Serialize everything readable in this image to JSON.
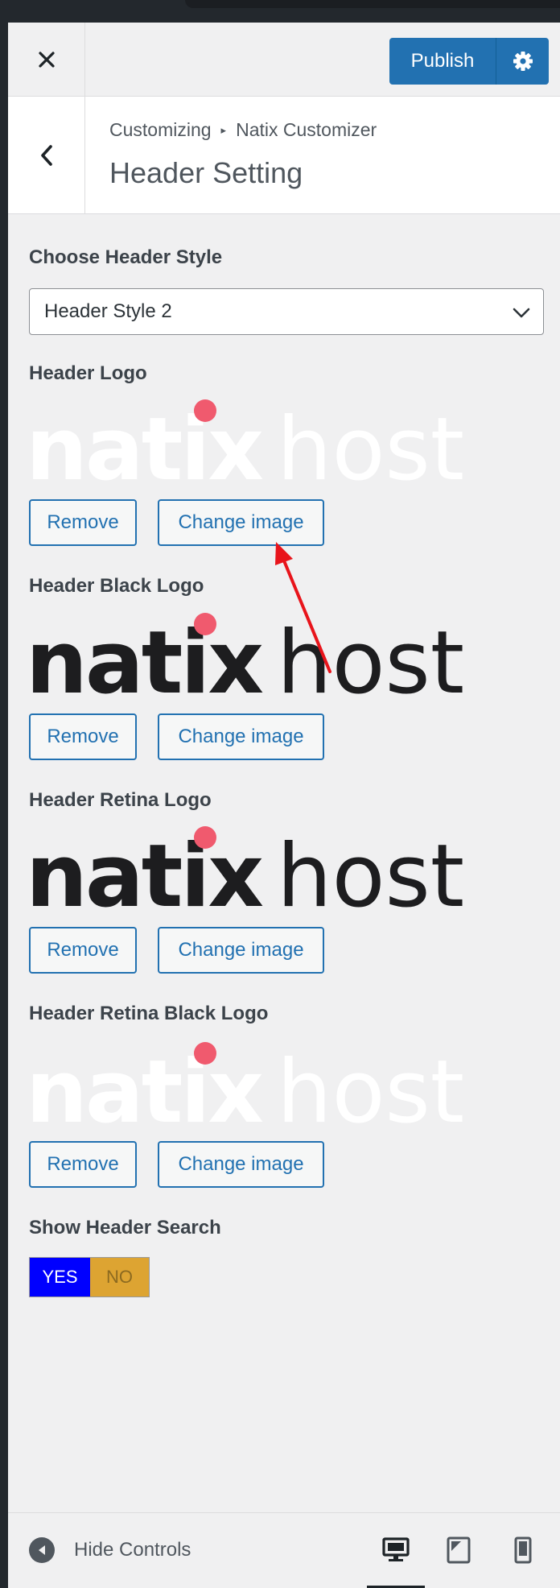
{
  "header": {
    "publish_label": "Publish"
  },
  "section": {
    "breadcrumb_root": "Customizing",
    "breadcrumb_sep": "▸",
    "breadcrumb_child": "Natix Customizer",
    "title": "Header Setting"
  },
  "controls": {
    "header_style": {
      "label": "Choose Header Style",
      "value": "Header Style 2"
    },
    "header_logo": {
      "label": "Header Logo",
      "logo_variant": "white-text-logo",
      "remove_label": "Remove",
      "change_label": "Change image"
    },
    "header_black_logo": {
      "label": "Header Black Logo",
      "logo_variant": "black-text-logo",
      "remove_label": "Remove",
      "change_label": "Change image"
    },
    "header_retina_logo": {
      "label": "Header Retina Logo",
      "logo_variant": "black-text-logo",
      "remove_label": "Remove",
      "change_label": "Change image"
    },
    "header_retina_black_logo": {
      "label": "Header Retina Black Logo",
      "logo_variant": "white-text-logo",
      "remove_label": "Remove",
      "change_label": "Change image"
    },
    "show_header_search": {
      "label": "Show Header Search",
      "yes_label": "YES",
      "no_label": "NO",
      "value": "YES"
    }
  },
  "logo": {
    "wordmark_bold": "natix",
    "wordmark_light": "host",
    "dot_color": "#f05a6e"
  },
  "footer": {
    "hide_controls_label": "Hide Controls",
    "devices": [
      "desktop-icon",
      "tablet-icon",
      "mobile-icon"
    ],
    "active_device": "desktop-icon"
  },
  "colors": {
    "accent": "#2271b1",
    "annotation_arrow": "#e8141b",
    "toggle_yes": "#0000ff",
    "toggle_no": "#dda432"
  }
}
